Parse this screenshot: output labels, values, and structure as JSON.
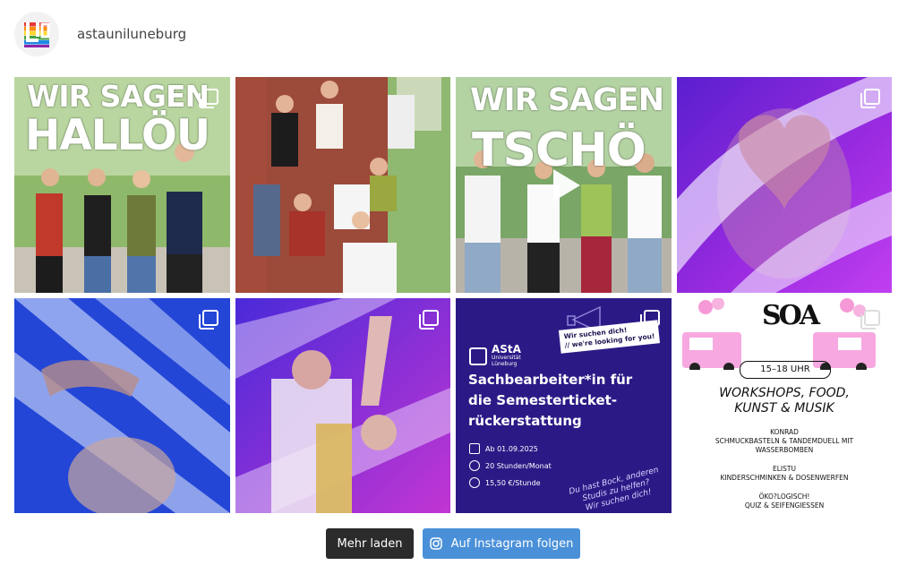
{
  "profile": {
    "username": "astauniluneburg"
  },
  "tiles": [
    {
      "type": "gallery",
      "overlay_line1": "WIR SAGEN",
      "overlay_line2": "HALLÖU"
    },
    {
      "type": "image"
    },
    {
      "type": "video",
      "overlay_line1": "WIR SAGEN",
      "overlay_line2": "TSCHÖ"
    },
    {
      "type": "gallery"
    },
    {
      "type": "gallery"
    },
    {
      "type": "gallery"
    },
    {
      "type": "gallery",
      "logo_name": "AStA",
      "logo_sub1": "Universität",
      "logo_sub2": "Lüneburg",
      "sticker_line1": "Wir suchen dich!",
      "sticker_line2": "// we're looking for you!",
      "title_line1": "Sachbearbeiter*in für",
      "title_line2": "die Semesterticket-",
      "title_line3": "rückerstattung",
      "info": [
        "Ab 01.09.2025",
        "20 Stunden/Monat",
        "15,50 €/Stunde"
      ],
      "handwritten1": "Du hast Bock, anderen",
      "handwritten2": "Studis zu helfen?",
      "handwritten3": "Wir suchen dich!"
    },
    {
      "type": "gallery",
      "logo_text": "SOA",
      "time": "15–18 UHR",
      "headline1": "WORKSHOPS, FOOD,",
      "headline2": "KUNST & MUSIK",
      "lines": [
        "KONRAD",
        "SCHMUCKBASTELN & TANDEMDUELL MIT",
        "WASSERBOMBEN",
        "",
        "ELISTU",
        "KINDERSCHMINKEN & DOSENWERFEN",
        "",
        "ÖKO?LOGISCH!",
        "QUIZ & SEIFENGIESSEN"
      ]
    }
  ],
  "actions": {
    "load_more": "Mehr laden",
    "follow": "Auf Instagram folgen"
  },
  "colors": {
    "follow_button": "#4a90d9",
    "load_more_button": "#2b2b2b",
    "job_bg": "#2b1a86"
  }
}
